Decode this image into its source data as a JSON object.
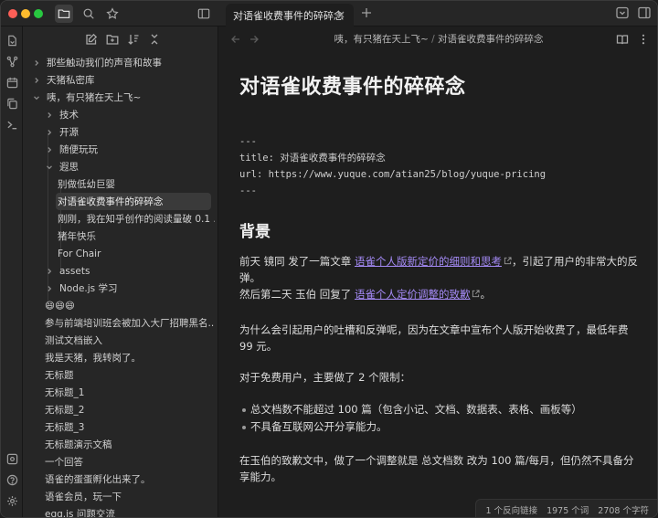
{
  "tab": {
    "title": "对语雀收费事件的碎碎念"
  },
  "breadcrumb": {
    "vault": "咦，有只猪在天上飞~",
    "sep": "/",
    "file": "对语雀收费事件的碎碎念"
  },
  "tree": [
    {
      "label": "那些触动我们的声音和故事",
      "chevron": "right"
    },
    {
      "label": "天猪私密库",
      "chevron": "right"
    },
    {
      "label": "咦，有只猪在天上飞~",
      "chevron": "down"
    },
    {
      "label": "技术",
      "chevron": "right"
    },
    {
      "label": "开源",
      "chevron": "right"
    },
    {
      "label": "随便玩玩",
      "chevron": "right"
    },
    {
      "label": "遐思",
      "chevron": "down"
    },
    {
      "label": "别做低幼巨婴"
    },
    {
      "label": "对语雀收费事件的碎碎念",
      "selected": true
    },
    {
      "label": "刚刚，我在知乎创作的阅读量破 0.1 ..."
    },
    {
      "label": "猪年快乐"
    },
    {
      "label": "For Chair"
    },
    {
      "label": "assets",
      "chevron": "right"
    },
    {
      "label": "Node.js 学习",
      "chevron": "right"
    },
    {
      "label": "😄😄😄"
    },
    {
      "label": "参与前端培训班会被加入大厂招聘黑名..."
    },
    {
      "label": "测试文档嵌入"
    },
    {
      "label": "我是天猪，我转岗了。"
    },
    {
      "label": "无标题"
    },
    {
      "label": "无标题_1"
    },
    {
      "label": "无标题_2"
    },
    {
      "label": "无标题_3"
    },
    {
      "label": "无标题演示文稿"
    },
    {
      "label": "一个回答"
    },
    {
      "label": "语雀的蛋蛋孵化出来了。"
    },
    {
      "label": "语雀会员，玩一下"
    },
    {
      "label": "egg.js 问题交流"
    }
  ],
  "doc": {
    "title": "对语雀收费事件的碎碎念",
    "frontmatter": {
      "open": "---",
      "title_line": "title: 对语雀收费事件的碎碎念",
      "url_line": "url: https://www.yuque.com/atian25/blog/yuque-pricing",
      "close": "---"
    },
    "heading": "背景",
    "p1": {
      "a": "前天 镜同 发了一篇文章 ",
      "link": "语雀个人版新定价的细则和思考",
      "b": "，引起了用户的非常大的反弹。"
    },
    "p2": {
      "a": "然后第二天 玉伯 回复了 ",
      "link": "语雀个人定价调整的致歉",
      "b": "。"
    },
    "p3": "为什么会引起用户的吐槽和反弹呢，因为在文章中宣布个人版开始收费了，最低年费 99 元。",
    "p4": "对于免费用户，主要做了 2 个限制：",
    "bullets": [
      "总文档数不能超过 100 篇（包含小记、文档、数据表、表格、画板等）",
      "不具备互联网公开分享能力。"
    ],
    "p5": "在玉伯的致歉文中，做了一个调整就是 总文档数 改为 100 篇/每月，但仍然不具备分享能力。"
  },
  "status": {
    "backlinks": "1 个反向链接",
    "words": "1975 个词",
    "chars": "2708 个字符"
  },
  "colors": {
    "accent": "#a48af5",
    "background": "#1e1e1e",
    "sidebar": "#262626"
  }
}
